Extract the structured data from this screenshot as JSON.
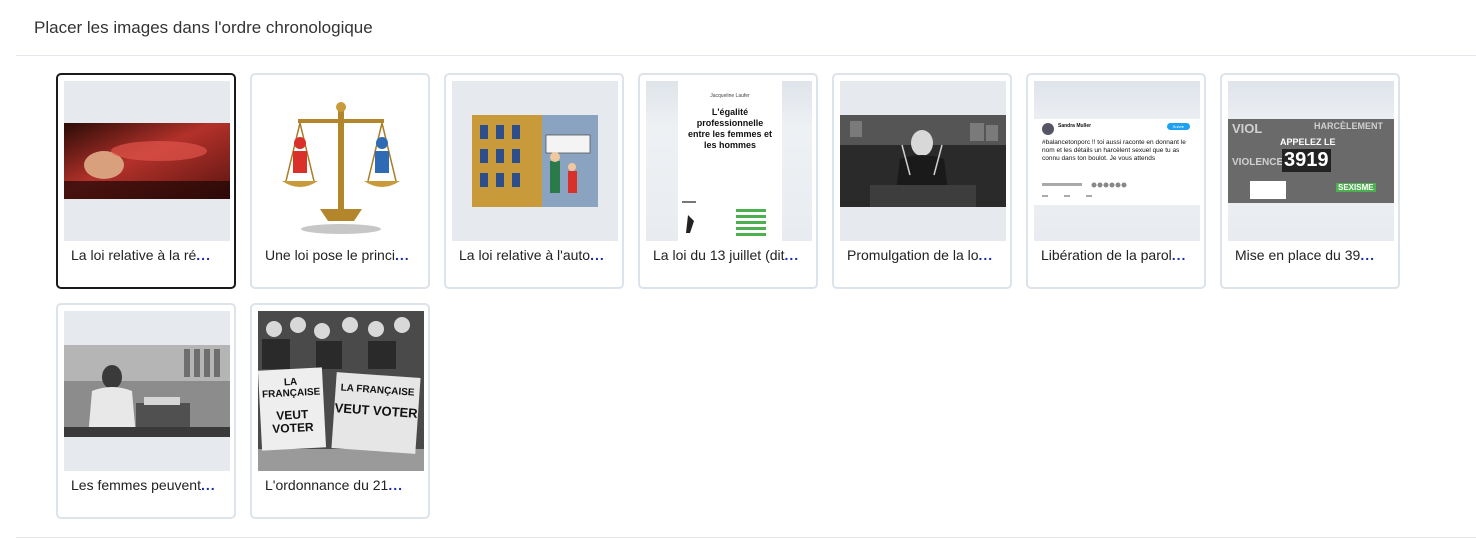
{
  "header": {
    "title": "Placer les images dans l'ordre chronologique"
  },
  "cards": [
    {
      "caption": "La loi relative à la ré",
      "ellipsis": "...",
      "image": "woman-lying-photo",
      "selected": true
    },
    {
      "caption": "Une loi pose le princi",
      "ellipsis": "...",
      "image": "scales-of-justice-illustration",
      "selected": false
    },
    {
      "caption": "La loi relative à l'auto",
      "ellipsis": "...",
      "image": "parental-authority-illustration",
      "selected": false
    },
    {
      "caption": "La loi du 13 juillet (dit",
      "ellipsis": "...",
      "image": "book-cover",
      "selected": false,
      "book": {
        "author": "Jacqueline Laufer",
        "title": "L'égalité professionnelle entre les femmes et les hommes"
      }
    },
    {
      "caption": "Promulgation de la lo",
      "ellipsis": "...",
      "image": "assembly-speech-photo",
      "selected": false
    },
    {
      "caption": "Libération de la parol",
      "ellipsis": "...",
      "image": "tweet-screenshot",
      "selected": false,
      "tweet": {
        "author": "Sandra Muller",
        "text": "#balancetonporc !! toi aussi raconte en donnant le nom et les détails un harcèlent sexuel que tu as connu dans ton boulot. Je vous attends",
        "button": "Suivre"
      }
    },
    {
      "caption": "Mise en place du 39",
      "ellipsis": "...",
      "image": "3919-poster",
      "selected": false,
      "poster": {
        "line1": "APPELEZ LE",
        "number": "3919",
        "words": [
          "VIOL",
          "HARCÈLEMENT",
          "VIOLENCES",
          "SEXISME"
        ]
      }
    },
    {
      "caption": "Les femmes peuvent",
      "ellipsis": "...",
      "image": "office-work-photo",
      "selected": false
    },
    {
      "caption": "L'ordonnance du 21",
      "ellipsis": "...",
      "image": "suffragettes-photo",
      "selected": false,
      "signs": [
        "LA FRANÇAISE",
        "VEUT VOTER"
      ]
    }
  ],
  "colors": {
    "border": "#dde3ea",
    "selected_border": "#1a1a1a",
    "ellipsis": "#1f2aa8"
  }
}
